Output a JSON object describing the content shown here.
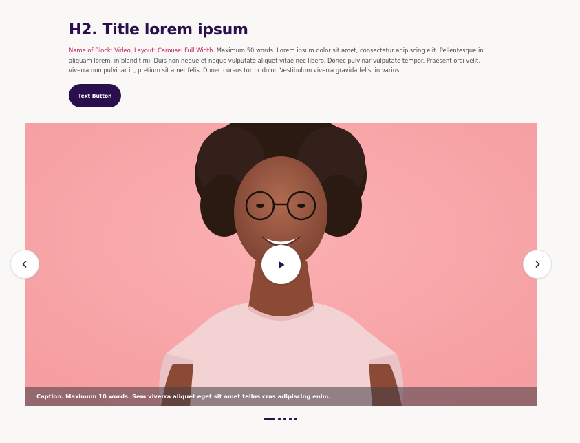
{
  "header": {
    "title": "H2. Title lorem ipsum",
    "description_highlight": "Name of Block: Video, Layout: Carousel Full Width.",
    "description_body": " Maximum 50 words. Lorem ipsum dolor sit amet, consectetur adipiscing elit. Pellentesque in aliquam lorem, in blandit mi. Duis non neque et neque vulputate aliquet vitae nec libero. Donec pulvinar vulputate tempor. Praesent orci velit, viverra non pulvinar in, pretium sit amet felis. Donec cursus tortor dolor. Vestibulum viverra gravida felis, in varius.",
    "button_label": "Text Button"
  },
  "carousel": {
    "caption": "Caption. Maximum 10 words. Sem viverra aliquet eget sit amet tellus cras adipiscing enim.",
    "slide_count": 5,
    "active_slide": 1,
    "play_icon": "play-icon",
    "prev_icon": "chevron-left-icon",
    "next_icon": "chevron-right-icon"
  },
  "colors": {
    "brand_dark": "#2a0e4d",
    "highlight": "#c2185b",
    "slide_background": "#f8a8aa",
    "page_background": "#f9f8f6"
  }
}
